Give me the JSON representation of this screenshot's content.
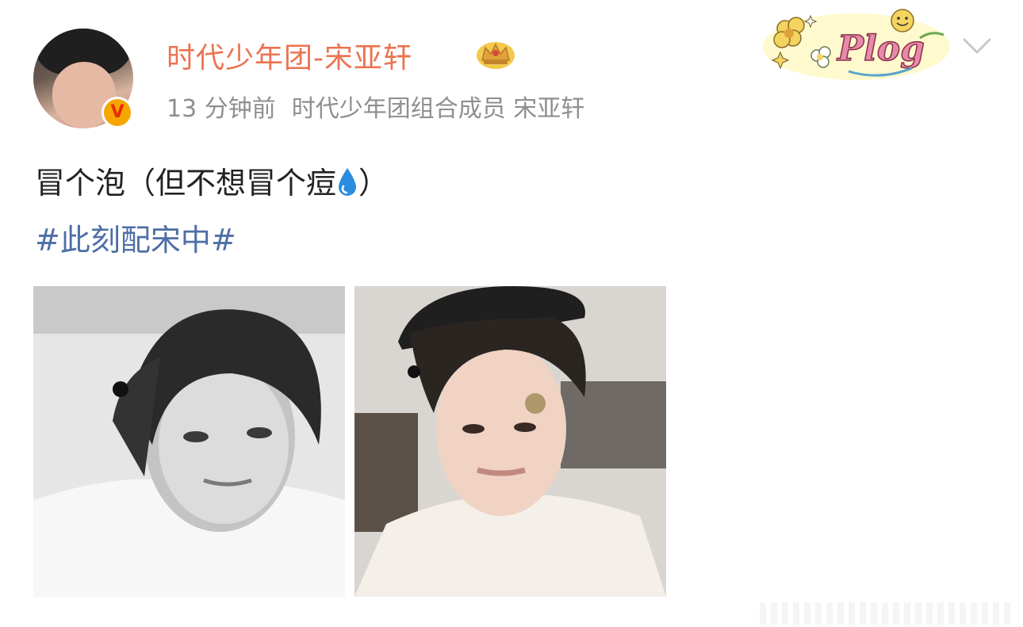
{
  "post": {
    "author": {
      "name": "时代少年团-宋亚轩",
      "avatar_icon": "avatar-photo",
      "verified_icon": "verified-v-badge",
      "verified_glyph": "V",
      "member_icon": "crown-badge-icon"
    },
    "meta": {
      "time": "13 分钟前",
      "source": "时代少年团组合成员 宋亚轩"
    },
    "text": {
      "main": "冒个泡（但不想冒个痘",
      "emoji": "water-drop-emoji",
      "close_paren": "）"
    },
    "hashtag": "#此刻配宋中#",
    "sticker": {
      "icon": "plog-sticker",
      "label": "Plog"
    },
    "menu_icon": "chevron-down-icon",
    "photos": [
      {
        "name": "photo-monochrome-selfie",
        "style": "black-and-white"
      },
      {
        "name": "photo-color-selfie",
        "style": "color"
      }
    ]
  },
  "colors": {
    "username": "#eb7350",
    "meta": "#8f8f8f",
    "hashtag": "#4e6ea6",
    "text": "#222222",
    "badge": "#f7a500"
  }
}
